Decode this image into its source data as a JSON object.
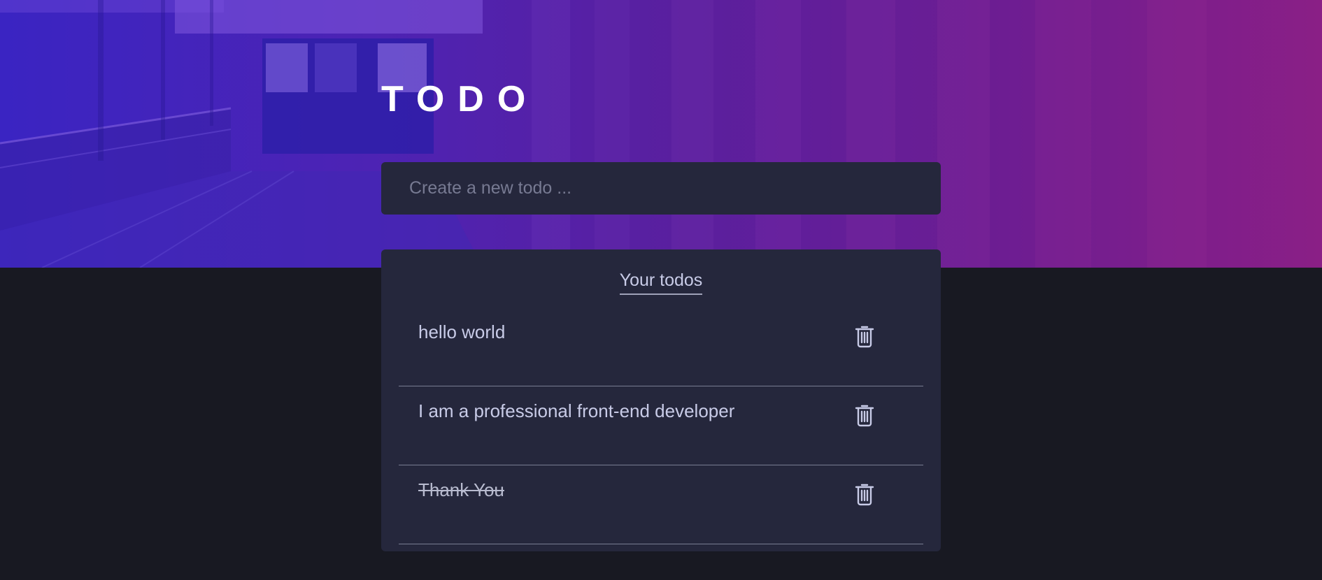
{
  "app": {
    "title": "TODO"
  },
  "new_todo": {
    "placeholder": "Create a new todo ...",
    "value": ""
  },
  "list": {
    "heading": "Your todos",
    "items": [
      {
        "text": "hello world",
        "completed": false,
        "delete_icon": "trash-icon"
      },
      {
        "text": "I am a professional front-end developer",
        "completed": false,
        "delete_icon": "trash-icon"
      },
      {
        "text": "Thank You",
        "completed": true,
        "delete_icon": "trash-icon"
      }
    ]
  },
  "colors": {
    "background": "#181922",
    "card": "#25273c",
    "text": "#c8cbe7",
    "hero_gradient_start": "#3a24c2",
    "hero_gradient_end": "#8a1f86"
  }
}
